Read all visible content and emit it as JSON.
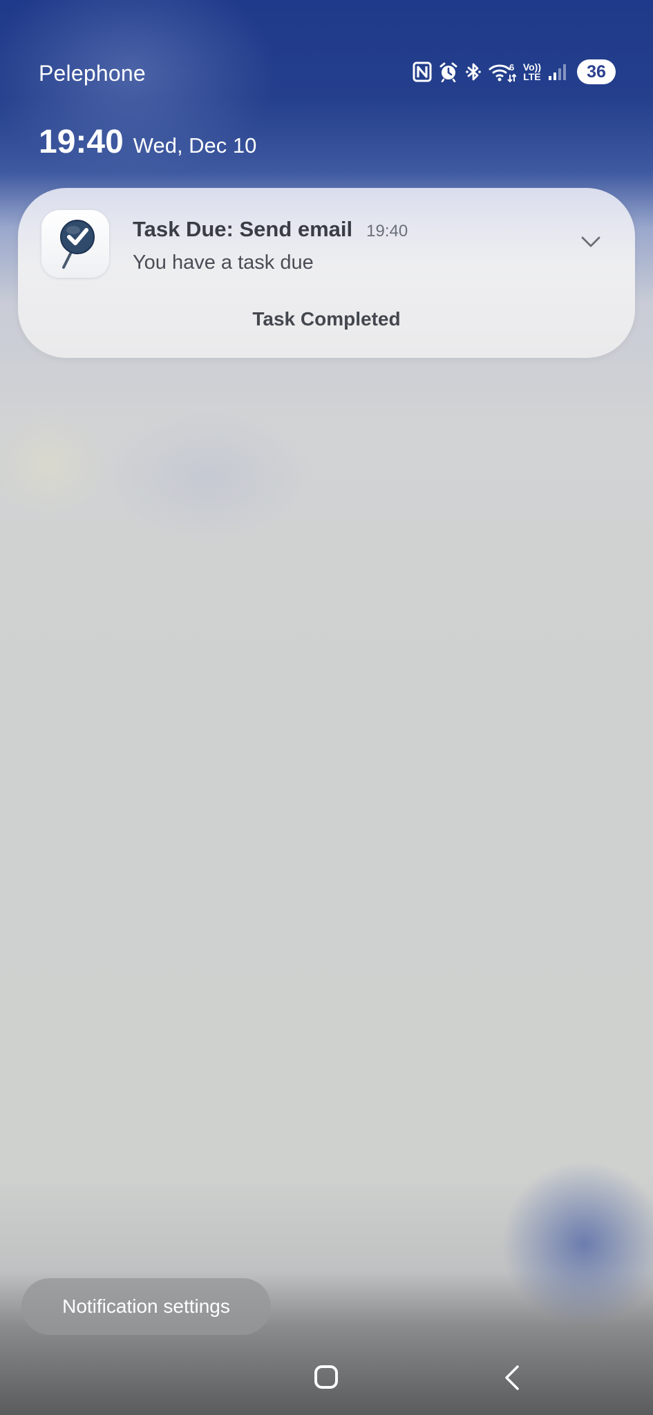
{
  "status_bar": {
    "carrier": "Pelephone",
    "battery_level": "36",
    "network_label_top": "Vo))",
    "network_label_bottom": "LTE",
    "wifi_superscript": "6",
    "icons": [
      "nfc-icon",
      "alarm-icon",
      "bluetooth-icon",
      "wifi-6-icon",
      "volte-lte-icon",
      "signal-icon",
      "battery-icon"
    ]
  },
  "lockscreen": {
    "time": "19:40",
    "date": "Wed, Dec 10"
  },
  "notification": {
    "app_icon": "task-pin-check-icon",
    "title": "Task Due: Send email",
    "time": "19:40",
    "body": "You have a task due",
    "action_label": "Task Completed"
  },
  "footer": {
    "settings_button_label": "Notification settings",
    "nav": [
      "home-icon",
      "back-icon"
    ]
  },
  "colors": {
    "top_gradient": "#1f3a8a",
    "background": "#cfd1cf",
    "accent_blob": "#5c70aa"
  }
}
